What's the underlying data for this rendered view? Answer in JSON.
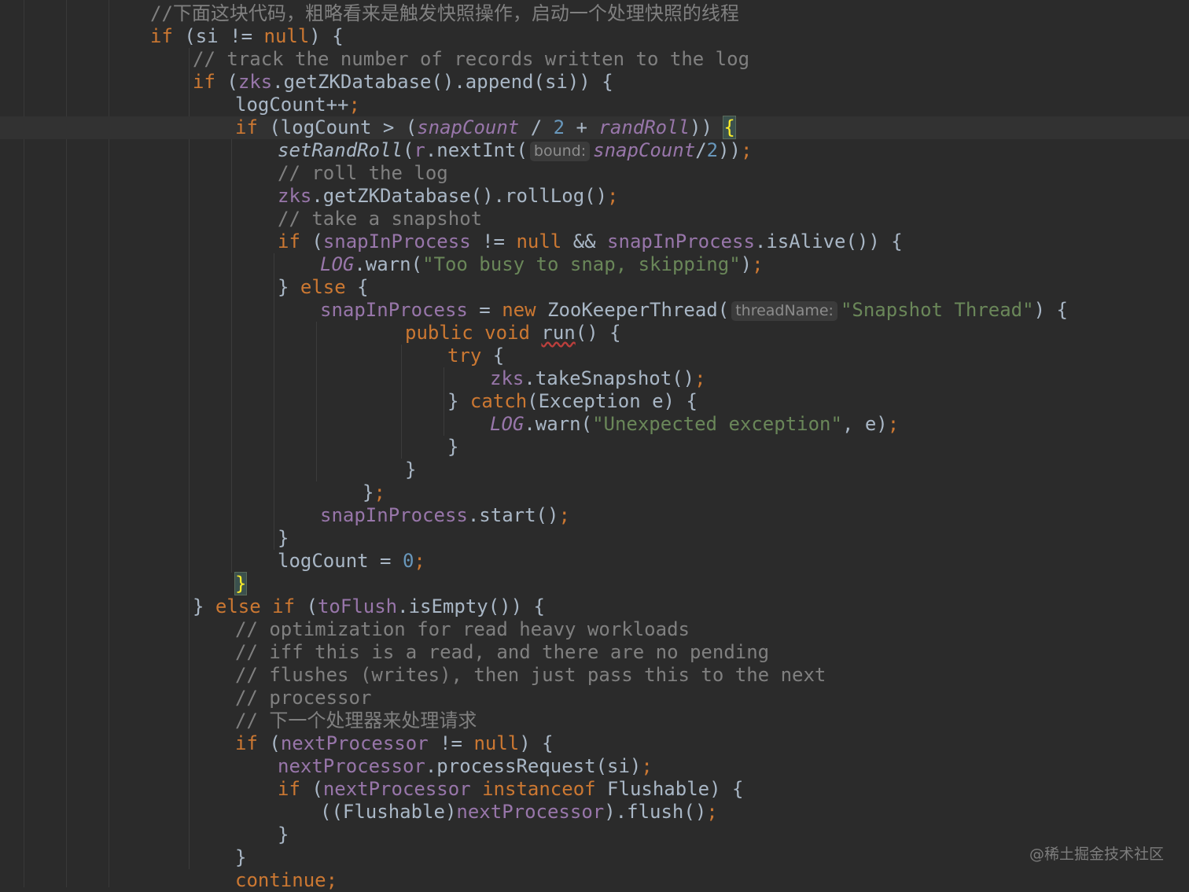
{
  "editor": {
    "colors": {
      "background": "#2b2b2b",
      "keyword": "#cc7832",
      "field": "#9876aa",
      "number": "#6897bb",
      "string": "#6a8759",
      "comment": "#808080",
      "text": "#a9b7c6"
    },
    "lines": [
      {
        "indent": 4,
        "tokens": [
          {
            "t": "//下面这块代码，粗略看来是触发快照操作，启动一个处理快照的线程",
            "c": "cmt"
          }
        ]
      },
      {
        "indent": 4,
        "tokens": [
          {
            "t": "if",
            "c": "kw"
          },
          {
            "t": " (si != "
          },
          {
            "t": "null",
            "c": "kw"
          },
          {
            "t": ") {"
          }
        ]
      },
      {
        "indent": 5,
        "tokens": [
          {
            "t": "// track the number of records written to the log",
            "c": "cmt"
          }
        ]
      },
      {
        "indent": 5,
        "tokens": [
          {
            "t": "if",
            "c": "kw"
          },
          {
            "t": " ("
          },
          {
            "t": "zks",
            "c": "fld"
          },
          {
            "t": ".getZKDatabase().append(si)) {"
          }
        ]
      },
      {
        "indent": 6,
        "tokens": [
          {
            "t": "logCount++"
          },
          {
            "t": ";",
            "c": "semi"
          }
        ]
      },
      {
        "indent": 6,
        "caretLine": true,
        "tokens": [
          {
            "t": "if",
            "c": "kw"
          },
          {
            "t": " (logCount > ("
          },
          {
            "t": "snapCount",
            "c": "sfld"
          },
          {
            "t": " / "
          },
          {
            "t": "2",
            "c": "num"
          },
          {
            "t": " + "
          },
          {
            "t": "randRoll",
            "c": "sfld"
          },
          {
            "t": ")) "
          },
          {
            "t": "",
            "c": "caret"
          },
          {
            "t": "{",
            "c": "brace-match"
          }
        ]
      },
      {
        "indent": 7,
        "tokens": [
          {
            "t": "setRandRoll",
            "c": "st"
          },
          {
            "t": "("
          },
          {
            "t": "r",
            "c": "fld"
          },
          {
            "t": ".nextInt("
          },
          {
            "hint": "bound:"
          },
          {
            "t": "snapCount",
            "c": "sfld"
          },
          {
            "t": "/"
          },
          {
            "t": "2",
            "c": "num"
          },
          {
            "t": "))"
          },
          {
            "t": ";",
            "c": "semi"
          }
        ]
      },
      {
        "indent": 7,
        "tokens": [
          {
            "t": "// roll the log",
            "c": "cmt"
          }
        ]
      },
      {
        "indent": 7,
        "tokens": [
          {
            "t": "zks",
            "c": "fld"
          },
          {
            "t": ".getZKDatabase().rollLog()"
          },
          {
            "t": ";",
            "c": "semi"
          }
        ]
      },
      {
        "indent": 7,
        "tokens": [
          {
            "t": "// take a snapshot",
            "c": "cmt"
          }
        ]
      },
      {
        "indent": 7,
        "tokens": [
          {
            "t": "if",
            "c": "kw"
          },
          {
            "t": " ("
          },
          {
            "t": "snapInProcess",
            "c": "fld"
          },
          {
            "t": " != "
          },
          {
            "t": "null",
            "c": "kw"
          },
          {
            "t": " && "
          },
          {
            "t": "snapInProcess",
            "c": "fld"
          },
          {
            "t": ".isAlive()) {"
          }
        ]
      },
      {
        "indent": 8,
        "tokens": [
          {
            "t": "LOG",
            "c": "sfld"
          },
          {
            "t": ".warn("
          },
          {
            "t": "\"Too busy to snap, skipping\"",
            "c": "str"
          },
          {
            "t": ")"
          },
          {
            "t": ";",
            "c": "semi"
          }
        ]
      },
      {
        "indent": 7,
        "tokens": [
          {
            "t": "} "
          },
          {
            "t": "else",
            "c": "kw"
          },
          {
            "t": " {"
          }
        ]
      },
      {
        "indent": 8,
        "tokens": [
          {
            "t": "snapInProcess",
            "c": "fld"
          },
          {
            "t": " = "
          },
          {
            "t": "new",
            "c": "kw"
          },
          {
            "t": " ZooKeeperThread("
          },
          {
            "hint": "threadName:"
          },
          {
            "t": "\"Snapshot Thread\"",
            "c": "str"
          },
          {
            "t": ") {"
          }
        ]
      },
      {
        "indent": 10,
        "tokens": [
          {
            "t": "public void",
            "c": "kw"
          },
          {
            "t": " "
          },
          {
            "t": "run",
            "c": "squiggle"
          },
          {
            "t": "() {"
          }
        ]
      },
      {
        "indent": 11,
        "tokens": [
          {
            "t": "try",
            "c": "kw"
          },
          {
            "t": " {"
          }
        ]
      },
      {
        "indent": 12,
        "tokens": [
          {
            "t": "zks",
            "c": "fld"
          },
          {
            "t": ".takeSnapshot()"
          },
          {
            "t": ";",
            "c": "semi"
          }
        ]
      },
      {
        "indent": 11,
        "tokens": [
          {
            "t": "} "
          },
          {
            "t": "catch",
            "c": "kw"
          },
          {
            "t": "(Exception e) {"
          }
        ]
      },
      {
        "indent": 12,
        "tokens": [
          {
            "t": "LOG",
            "c": "sfld"
          },
          {
            "t": ".warn("
          },
          {
            "t": "\"Unexpected exception\"",
            "c": "str"
          },
          {
            "t": ", e)"
          },
          {
            "t": ";",
            "c": "semi"
          }
        ]
      },
      {
        "indent": 11,
        "tokens": [
          {
            "t": "}"
          }
        ]
      },
      {
        "indent": 10,
        "tokens": [
          {
            "t": "}"
          }
        ]
      },
      {
        "indent": 9,
        "tokens": [
          {
            "t": "}"
          },
          {
            "t": ";",
            "c": "semi"
          }
        ]
      },
      {
        "indent": 8,
        "tokens": [
          {
            "t": "snapInProcess",
            "c": "fld"
          },
          {
            "t": ".start()"
          },
          {
            "t": ";",
            "c": "semi"
          }
        ]
      },
      {
        "indent": 7,
        "tokens": [
          {
            "t": "}"
          }
        ]
      },
      {
        "indent": 7,
        "tokens": [
          {
            "t": "logCount = "
          },
          {
            "t": "0",
            "c": "num"
          },
          {
            "t": ";",
            "c": "semi"
          }
        ]
      },
      {
        "indent": 6,
        "tokens": [
          {
            "t": "}",
            "c": "brace-match"
          }
        ]
      },
      {
        "indent": 5,
        "tokens": [
          {
            "t": "} "
          },
          {
            "t": "else if",
            "c": "kw"
          },
          {
            "t": " ("
          },
          {
            "t": "toFlush",
            "c": "fld"
          },
          {
            "t": ".isEmpty()) {"
          }
        ]
      },
      {
        "indent": 6,
        "tokens": [
          {
            "t": "// optimization for read heavy workloads",
            "c": "cmt"
          }
        ]
      },
      {
        "indent": 6,
        "tokens": [
          {
            "t": "// iff this is a read, and there are no pending",
            "c": "cmt"
          }
        ]
      },
      {
        "indent": 6,
        "tokens": [
          {
            "t": "// flushes (writes), then just pass this to the next",
            "c": "cmt"
          }
        ]
      },
      {
        "indent": 6,
        "tokens": [
          {
            "t": "// processor",
            "c": "cmt"
          }
        ]
      },
      {
        "indent": 6,
        "tokens": [
          {
            "t": "// 下一个处理器来处理请求",
            "c": "cmt"
          }
        ]
      },
      {
        "indent": 6,
        "tokens": [
          {
            "t": "if",
            "c": "kw"
          },
          {
            "t": " ("
          },
          {
            "t": "nextProcessor",
            "c": "fld"
          },
          {
            "t": " != "
          },
          {
            "t": "null",
            "c": "kw"
          },
          {
            "t": ") {"
          }
        ]
      },
      {
        "indent": 7,
        "tokens": [
          {
            "t": "nextProcessor",
            "c": "fld"
          },
          {
            "t": ".processRequest(si)"
          },
          {
            "t": ";",
            "c": "semi"
          }
        ]
      },
      {
        "indent": 7,
        "tokens": [
          {
            "t": "if",
            "c": "kw"
          },
          {
            "t": " ("
          },
          {
            "t": "nextProcessor",
            "c": "fld"
          },
          {
            "t": " "
          },
          {
            "t": "instanceof",
            "c": "kw"
          },
          {
            "t": " Flushable) {"
          }
        ]
      },
      {
        "indent": 8,
        "tokens": [
          {
            "t": "((Flushable)"
          },
          {
            "t": "nextProcessor",
            "c": "fld"
          },
          {
            "t": ").flush()"
          },
          {
            "t": ";",
            "c": "semi"
          }
        ]
      },
      {
        "indent": 7,
        "tokens": [
          {
            "t": "}"
          }
        ]
      },
      {
        "indent": 6,
        "tokens": [
          {
            "t": "}"
          }
        ]
      },
      {
        "indent": 6,
        "tokens": [
          {
            "t": "continue",
            "c": "kw"
          },
          {
            "t": ";",
            "c": "semi"
          }
        ]
      }
    ]
  },
  "watermark": "@稀土掘金技术社区"
}
